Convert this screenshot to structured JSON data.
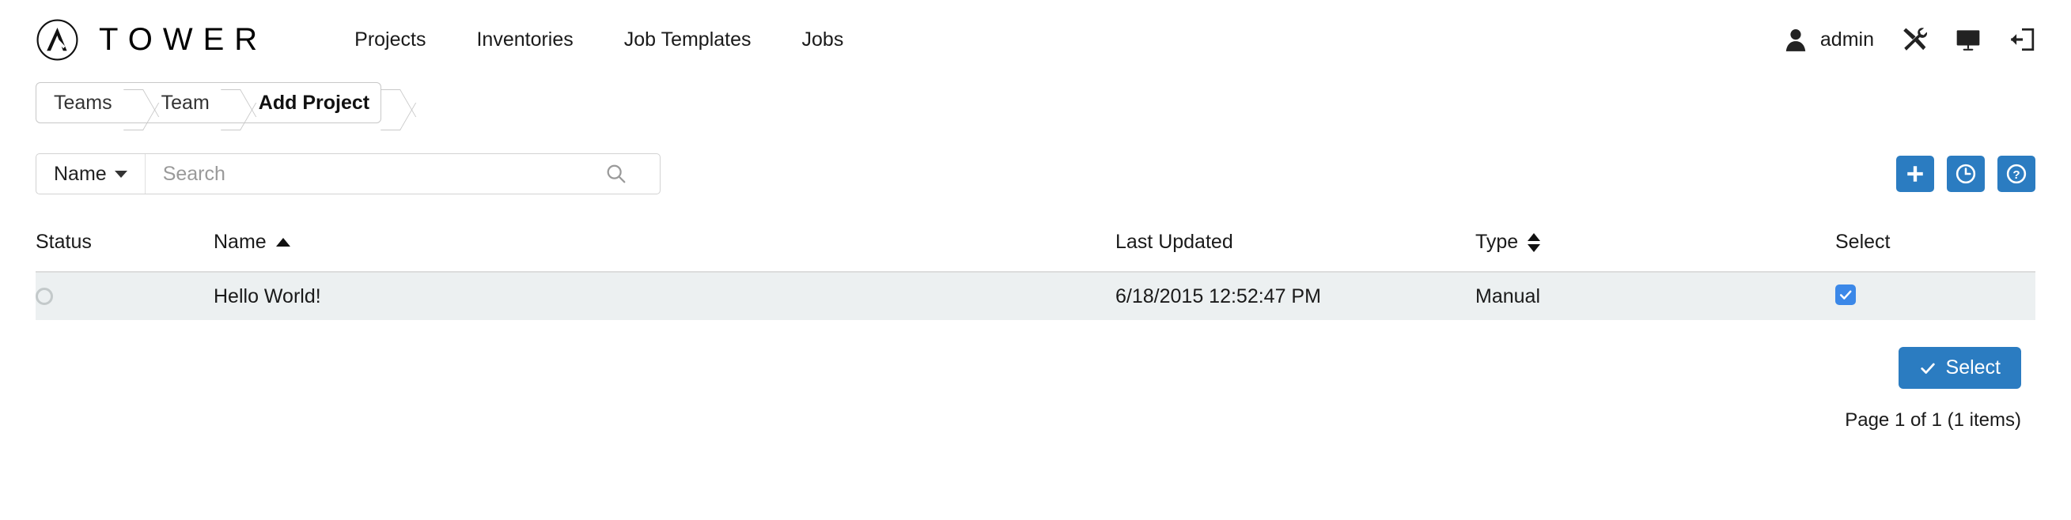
{
  "header": {
    "brand_name": "TOWER",
    "logo_icon": "ansible-a-logo-icon",
    "nav": [
      {
        "label": "Projects",
        "name": "projects"
      },
      {
        "label": "Inventories",
        "name": "inventories"
      },
      {
        "label": "Job Templates",
        "name": "job-templates"
      },
      {
        "label": "Jobs",
        "name": "jobs"
      }
    ],
    "user": {
      "name": "admin",
      "icon": "user-icon"
    },
    "icons": [
      {
        "name": "tools-icon"
      },
      {
        "name": "monitor-icon"
      },
      {
        "name": "logout-icon"
      }
    ]
  },
  "breadcrumb": {
    "items": [
      {
        "label": "Teams",
        "active": false
      },
      {
        "label": "Team",
        "active": false
      },
      {
        "label": "Add Project",
        "active": true
      }
    ]
  },
  "toolbar": {
    "search_key_label": "Name",
    "search_placeholder": "Search",
    "search_value": "",
    "buttons": [
      {
        "name": "add-button",
        "icon": "plus-icon"
      },
      {
        "name": "schedule-button",
        "icon": "clock-icon"
      },
      {
        "name": "help-button",
        "icon": "question-icon"
      }
    ]
  },
  "table": {
    "columns": [
      {
        "label": "Status",
        "sort": "none"
      },
      {
        "label": "Name",
        "sort": "asc"
      },
      {
        "label": "Last Updated",
        "sort": "none"
      },
      {
        "label": "Type",
        "sort": "both"
      },
      {
        "label": "Select",
        "sort": "none"
      }
    ],
    "rows": [
      {
        "status": "idle",
        "name": "Hello World!",
        "last_updated": "6/18/2015 12:52:47 PM",
        "type": "Manual",
        "selected": true
      }
    ]
  },
  "footer": {
    "select_button_label": "Select",
    "pager_text": "Page 1 of 1 (1 items)"
  },
  "colors": {
    "accent_blue": "#2b7cc1",
    "checkbox_blue": "#3b88e8",
    "row_bg": "#ecf0f1",
    "border": "#dcdcdc"
  }
}
